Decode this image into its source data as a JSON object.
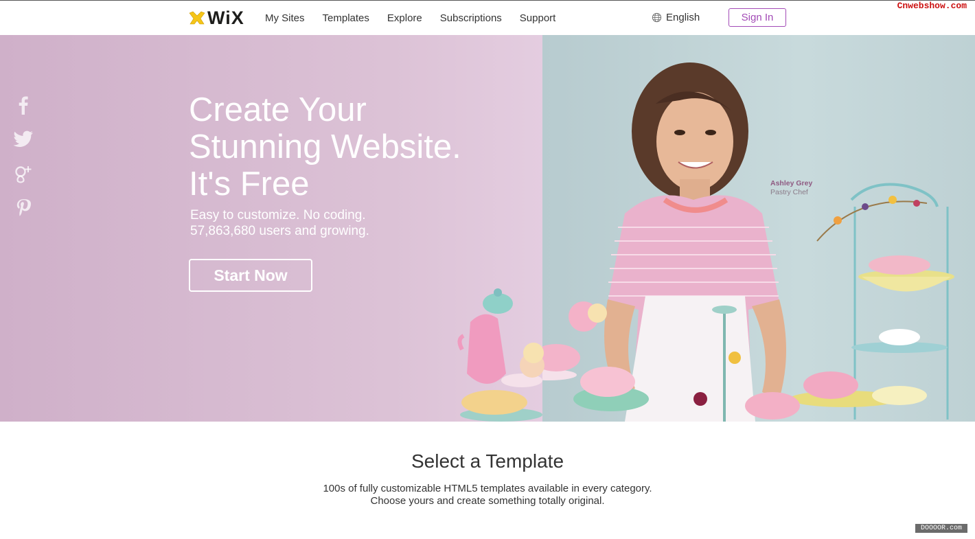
{
  "header": {
    "logo_text": "WiX",
    "nav": [
      "My Sites",
      "Templates",
      "Explore",
      "Subscriptions",
      "Support"
    ],
    "language": "English",
    "sign_in": "Sign In"
  },
  "watermarks": {
    "top": "Cnwebshow.com",
    "bottom": "DOOOOR.com"
  },
  "hero": {
    "headline": [
      "Create Your",
      "Stunning Website.",
      "It's Free"
    ],
    "subline": [
      "Easy to customize. No coding.",
      "57,863,680 users and growing."
    ],
    "cta": "Start Now",
    "photo_credit": {
      "name": "Ashley Grey",
      "role": "Pastry Chef"
    },
    "social": [
      "facebook-icon",
      "twitter-icon",
      "google-plus-icon",
      "pinterest-icon"
    ]
  },
  "templates_section": {
    "title": "Select a Template",
    "description": [
      "100s of fully customizable HTML5 templates available in every category.",
      "Choose yours and create something totally original."
    ]
  },
  "colors": {
    "accent": "#a24ab6",
    "hero_left": "#d9bdd3",
    "hero_right": "#c2d6d8"
  }
}
